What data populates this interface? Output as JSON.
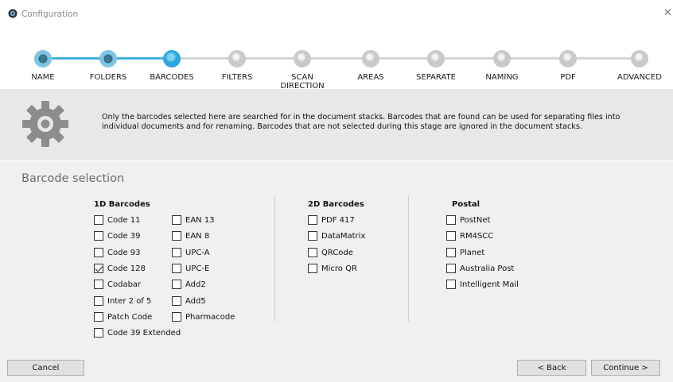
{
  "window": {
    "title": "Configuration",
    "icon": "gear-icon",
    "close_icon": "close-icon"
  },
  "steps": [
    {
      "label": "NAME",
      "state": "done"
    },
    {
      "label": "FOLDERS",
      "state": "done"
    },
    {
      "label": "BARCODES",
      "state": "current"
    },
    {
      "label": "FILTERS",
      "state": "todo"
    },
    {
      "label": "SCAN\nDIRECTION",
      "state": "todo"
    },
    {
      "label": "AREAS",
      "state": "todo"
    },
    {
      "label": "SEPARATE",
      "state": "todo"
    },
    {
      "label": "NAMING",
      "state": "todo"
    },
    {
      "label": "PDF",
      "state": "todo"
    },
    {
      "label": "ADVANCED",
      "state": "todo"
    }
  ],
  "info": {
    "icon": "gear-icon",
    "text": "Only the barcodes selected here are searched for in the document stacks. Barcodes that are found can be used for separating files into individual documents and for renaming. Barcodes that are not selected during this stage are ignored in the document stacks."
  },
  "section_title": "Barcode selection",
  "groups": {
    "oneD": {
      "title": "1D Barcodes",
      "col1": [
        {
          "label": "Code 11",
          "checked": false
        },
        {
          "label": "Code 39",
          "checked": false
        },
        {
          "label": "Code 93",
          "checked": false
        },
        {
          "label": "Code 128",
          "checked": true
        },
        {
          "label": "Codabar",
          "checked": false
        },
        {
          "label": "Inter 2 of 5",
          "checked": false
        },
        {
          "label": "Patch Code",
          "checked": false
        },
        {
          "label": "Code 39 Extended",
          "checked": false
        }
      ],
      "col2": [
        {
          "label": "EAN 13",
          "checked": false
        },
        {
          "label": "EAN 8",
          "checked": false
        },
        {
          "label": "UPC-A",
          "checked": false
        },
        {
          "label": "UPC-E",
          "checked": false
        },
        {
          "label": "Add2",
          "checked": false
        },
        {
          "label": "Add5",
          "checked": false
        },
        {
          "label": "Pharmacode",
          "checked": false
        }
      ]
    },
    "twoD": {
      "title": "2D Barcodes",
      "items": [
        {
          "label": "PDF 417",
          "checked": false
        },
        {
          "label": "DataMatrix",
          "checked": false
        },
        {
          "label": "QRCode",
          "checked": false
        },
        {
          "label": "Micro QR",
          "checked": false
        }
      ]
    },
    "postal": {
      "title": "Postal",
      "items": [
        {
          "label": "PostNet",
          "checked": false
        },
        {
          "label": "RM4SCC",
          "checked": false
        },
        {
          "label": "Planet",
          "checked": false
        },
        {
          "label": "Australia Post",
          "checked": false
        },
        {
          "label": "Intelligent Mail",
          "checked": false
        }
      ]
    }
  },
  "buttons": {
    "cancel": "Cancel",
    "back": "< Back",
    "continue": "Continue >"
  },
  "colors": {
    "progress_done": "#41b1e0",
    "progress_todo": "#d4d4d4",
    "info_bg": "#e8e8e8",
    "panel_bg": "#f0f0f0"
  }
}
